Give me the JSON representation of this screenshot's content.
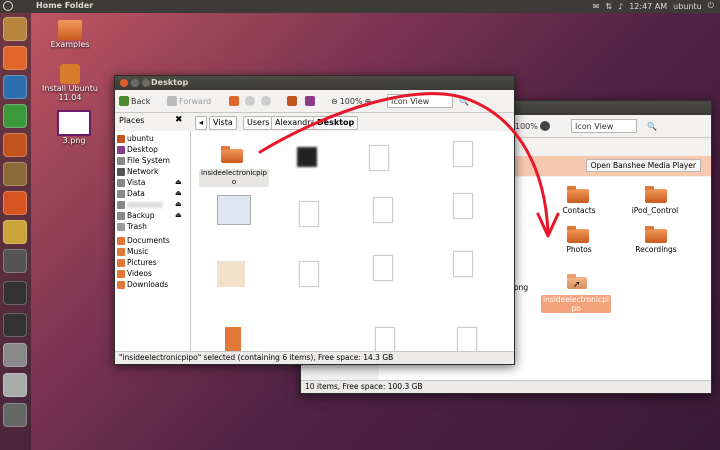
{
  "topbar": {
    "title": "Home Folder",
    "time": "12:47 AM",
    "user": "ubuntu"
  },
  "desktop": {
    "icons": [
      {
        "label": "Examples"
      },
      {
        "label": "Install Ubuntu 11.04"
      },
      {
        "label": "3.png"
      }
    ]
  },
  "front": {
    "title": "Desktop",
    "toolbar": {
      "back": "Back",
      "forward": "Forward",
      "zoom": "100%",
      "view": "Icon View"
    },
    "path": [
      "Vista",
      "Users",
      "Alexandra",
      "Desktop"
    ],
    "places_header": "Places",
    "places": [
      "ubuntu",
      "Desktop",
      "File System",
      "Network",
      "Vista",
      "Data",
      "",
      "Backup",
      "Trash",
      "Documents",
      "Music",
      "Pictures",
      "Videos",
      "Downloads"
    ],
    "selected_folder": "insideelectronicpipo",
    "status": "\"insideelectronicpipo\" selected (containing 6 items), Free space: 14.3 GB"
  },
  "back": {
    "toolbar": {
      "zoom": "100%",
      "view": "Icon View"
    },
    "banner_button": "Open Banshee Media Player",
    "folders": [
      "Contacts",
      "iPod_Control",
      "Photos",
      "Recordings"
    ],
    "fragment": "png",
    "dropped_folder": "insideelectronicpipo",
    "status": "10 items, Free space: 100.3 GB"
  },
  "colors": {
    "accent": "#e45c2e",
    "arrow": "#e8172a",
    "selection": "#f3a27c"
  }
}
